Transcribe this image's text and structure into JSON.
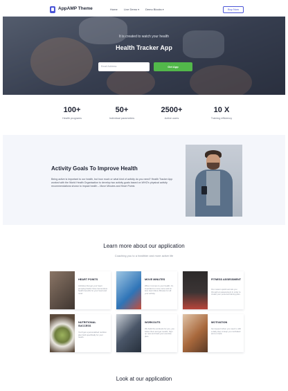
{
  "nav": {
    "brand": "AppAMP Theme",
    "items": [
      {
        "label": "Home"
      },
      {
        "label": "Live Demo"
      },
      {
        "label": "Demo Blocks"
      }
    ],
    "cta": "Buy Now"
  },
  "hero": {
    "subtitle": "It is created to watch your health",
    "title": "Health Tracker App",
    "input_placeholder": "Email Address",
    "button": "Get App"
  },
  "stats": [
    {
      "value": "100+",
      "label": "Health programs"
    },
    {
      "value": "50+",
      "label": "Individual parameters"
    },
    {
      "value": "2500+",
      "label": "Active users"
    },
    {
      "value": "10 X",
      "label": "Training efficiency"
    }
  ],
  "activity": {
    "title": "Activity Goals To Improve Health",
    "text": "Being active is important to our health, but how much or what kind of activity do you need? Health Tracker App worked with the World Health Organisation to develop two activity goals based on WHO's physical activity recommendations shown to impact health – Move Minutes and Heart Points"
  },
  "learn": {
    "title": "Learn more about our application",
    "subtitle": "Coaching you to a healthier and more active life",
    "cards": [
      {
        "title": "HEART POINTS",
        "text": "Activities that get your heart pumping harder have tremendous health benefits for your heart and mind.",
        "color": "#6c5a4e"
      },
      {
        "title": "MOVE MINUTES",
        "text": "When it comes to your health, it's important to move more and sit less. Earn Move Minutes for all your activity.",
        "color": "#2f74b7"
      },
      {
        "title": "FITNESS ASSESSMENT",
        "text": "Our custom quick test lets you through an assessment in order to create your personal training plan.",
        "color": "#b8453a"
      },
      {
        "title": "NUTRITIONAL SUCCESS",
        "text": "You'll get a personalized nutrition plan built specifically for your needs.",
        "color": "#7c8a4c"
      },
      {
        "title": "WORKOUTS",
        "text": "We build the workouts for you, you follow them and get results. Sign up now and track your exercise plan.",
        "color": "#4a5668"
      },
      {
        "title": "MOTIVATION",
        "text": "Get support when you need it, with a daily step to keep you motivated and on track.",
        "color": "#a8683c"
      }
    ]
  },
  "look": {
    "title": "Look at our application"
  },
  "icons": {
    "logo": "phone-app-icon",
    "caret": "chevron-down-icon"
  },
  "colors": {
    "accent": "#4a55d6",
    "cta_green": "#52b84a"
  }
}
